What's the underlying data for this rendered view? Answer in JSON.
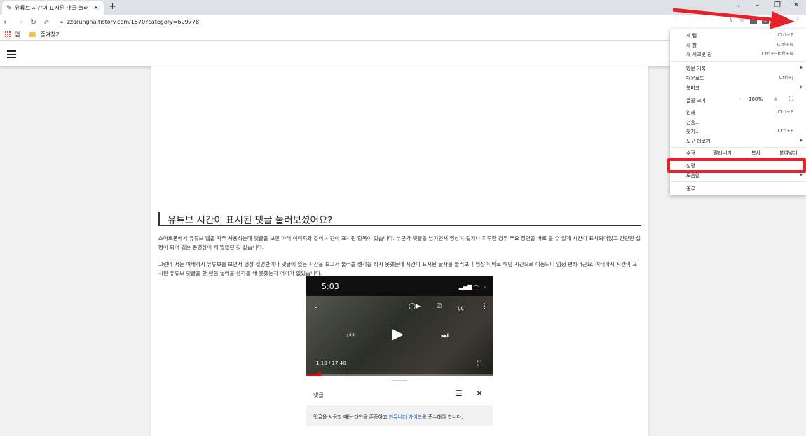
{
  "browser": {
    "tab_title": "유튜브 시간이 표시된 댓글 눌러",
    "url": "zzarungna.tistory.com/1570?category=609778",
    "bookmarks": [
      "앱",
      "즐겨찾기"
    ]
  },
  "article": {
    "heading": "유튜브 시간이 표시된 댓글 눌러보셨어요?",
    "paragraph1": "스마트폰에서 유튜브 앱을 자주 사용하는데 댓글을 보면 아래 이미지와 같이 시간이 표시된 항목이 있습니다. 누군가 댓글을 남기면서 영상이 길거나 지루한 경우 주요 장면을 바로 볼 수 있게 시간이 표시되어있고 간단한 설명이 되어 있는  동영상이 꽤 많았던 것 같습니다.",
    "paragraph2": "그런데 저는 여태까지 유튜브를 보면서 영상 설명란이나 댓글에 있는 시간을 보고서 눌러볼 생각을 하지 못했는데 시간이 표시된 글자를 눌러보니 영상이 바로 해당 시간으로 이동되니 엄청 편하더군요. 여태까지 시간이 표시된 유튜브 댓글을 한 번쯤 눌러볼 생각을 왜 못했는지 어이가 없었습니다."
  },
  "phone": {
    "status_time": "5:03",
    "video_time": "1:10 / 17:40",
    "progress": 0.066,
    "comments_title": "댓글",
    "notice_before": "댓글을 사용할 때는 타인을 존중하고 ",
    "notice_link": "커뮤니티 가이드",
    "notice_after": "를 준수해야 합니다."
  },
  "menu": {
    "new_tab": "새 탭",
    "new_tab_sc": "Ctrl+T",
    "new_window": "새 창",
    "new_window_sc": "Ctrl+N",
    "incognito": "새 시크릿 창",
    "incognito_sc": "Ctrl+Shift+N",
    "history": "방문 기록",
    "downloads": "다운로드",
    "downloads_sc": "Ctrl+J",
    "bookmarks": "북마크",
    "font_size": "글꼴 크기",
    "zoom_minus": "-",
    "zoom_value": "100%",
    "zoom_plus": "+",
    "print": "인쇄",
    "print_sc": "Ctrl+P",
    "cast": "전송...",
    "find": "찾기...",
    "find_sc": "Ctrl+F",
    "more_tools": "도구 더보기",
    "edit": "수정",
    "cut": "잘라내기",
    "copy": "복사",
    "paste": "붙여넣기",
    "settings": "설정",
    "help": "도움말",
    "exit": "종료"
  },
  "colors": {
    "highlight": "#e8202a",
    "link": "#065fd4",
    "progress": "#ff0000"
  }
}
